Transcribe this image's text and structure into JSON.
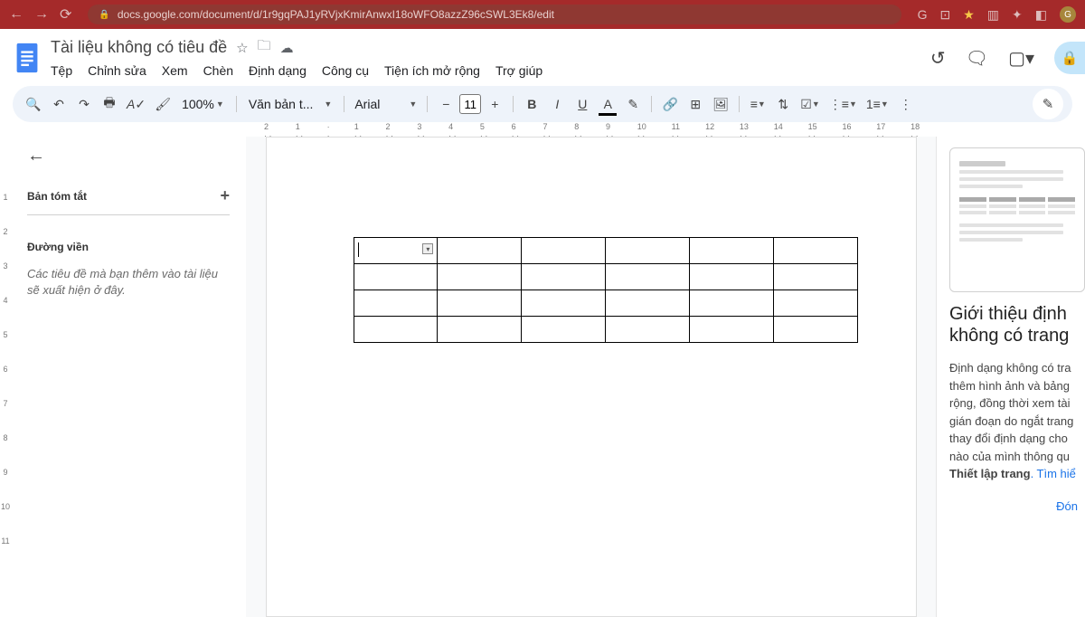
{
  "browser": {
    "url": "docs.google.com/document/d/1r9gqPAJ1yRVjxKmirAnwxI18oWFO8azzZ96cSWL3Ek8/edit",
    "avatar_letter": "G"
  },
  "header": {
    "title": "Tài liệu không có tiêu đề",
    "menus": {
      "file": "Tệp",
      "edit": "Chỉnh sửa",
      "view": "Xem",
      "insert": "Chèn",
      "format": "Định dạng",
      "tools": "Công cụ",
      "extensions": "Tiện ích mở rộng",
      "help": "Trợ giúp"
    }
  },
  "toolbar": {
    "zoom": "100%",
    "style": "Văn bản t...",
    "font": "Arial",
    "font_size": "11"
  },
  "ruler_h": [
    "2",
    "1",
    "",
    "1",
    "2",
    "3",
    "4",
    "5",
    "6",
    "7",
    "8",
    "9",
    "10",
    "11",
    "12",
    "13",
    "14",
    "15",
    "16",
    "17",
    "18"
  ],
  "ruler_v": [
    "",
    "1",
    "2",
    "3",
    "4",
    "5",
    "6",
    "7",
    "8",
    "9",
    "10",
    "11"
  ],
  "left_panel": {
    "summary": "Bản tóm tắt",
    "outline": "Đường viền",
    "outline_placeholder": "Các tiêu đề mà bạn thêm vào tài liệu sẽ xuất hiện ở đây."
  },
  "document": {
    "table": {
      "rows": 4,
      "cols": 6
    }
  },
  "right_panel": {
    "title": "Giới thiệu định không có trang",
    "body_1": "Định dạng không có tra thêm hình ảnh và bảng rộng, đồng thời xem tài gián đoạn do ngắt trang thay đổi định dạng cho nào của mình thông qu ",
    "body_bold": "Thiết lập trang",
    "body_2": ". Tìm hiể",
    "close": "Đón"
  }
}
